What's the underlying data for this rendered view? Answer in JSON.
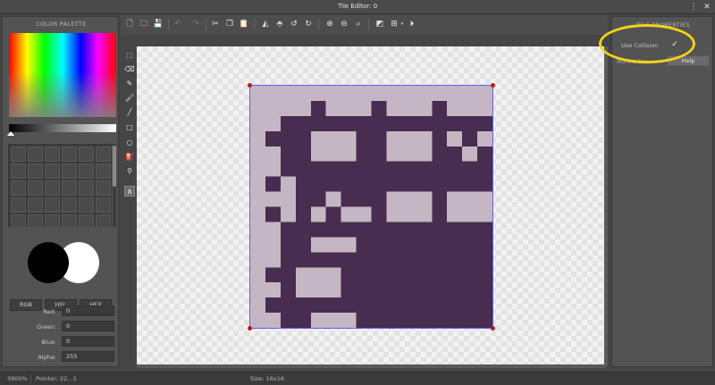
{
  "window": {
    "title": "Tile Editor: 0",
    "menu_icon": "⋮",
    "close_icon": "✕"
  },
  "palette": {
    "title": "COLOR PALETTE",
    "modes": [
      "RGB",
      "HSL",
      "HEX"
    ],
    "primary_color": "#000000",
    "secondary_color": "#ffffff",
    "fields": [
      {
        "label": "Red:",
        "value": "0"
      },
      {
        "label": "Green:",
        "value": "0"
      },
      {
        "label": "Blue:",
        "value": "0"
      },
      {
        "label": "Alpha:",
        "value": "255"
      }
    ]
  },
  "toolbar": {
    "icons": [
      "new-file-icon",
      "open-folder-icon",
      "save-icon",
      "undo-icon",
      "redo-icon",
      "cut-icon",
      "copy-icon",
      "paste-icon",
      "flip-horizontal-icon",
      "flip-vertical-icon",
      "rotate-left-icon",
      "rotate-right-icon",
      "zoom-in-icon",
      "zoom-out-icon",
      "zoom-fit-icon",
      "fill-toggle-icon",
      "grid-icon",
      "play-icon"
    ]
  },
  "tools": [
    "select",
    "eraser",
    "pencil",
    "brush",
    "line",
    "rectangle",
    "ellipse",
    "bucket-fill",
    "eyedropper",
    "transform"
  ],
  "properties": {
    "title": "TILE PROPERTIES",
    "use_collision_label": "Use Collision",
    "use_collision": true,
    "info_label": "More Infor...",
    "help_label": "Help"
  },
  "tile": {
    "size": 16,
    "colors": {
      "dark": "#472d4f",
      "light": "#c4b7c3"
    },
    "pixels": [
      "LLLLLLLLLLLLLLLL",
      "LLLLDLLLDLLLDLLL",
      "LLDDDDDDDDDDDDDD",
      "LDDDLLLDDLLLDLDL",
      "LLDDLLLDDLLLDDLD",
      "LLDDDDDDDDDDDDDD",
      "LDLDDDDDDDDDDDDD",
      "LLLDDLDDDLLLDLLL",
      "LDLDLDLLDLLLDLLL",
      "LLDDDDDDDDDDDDDD",
      "LLDDLLLDDDDDDDDD",
      "LLDDDDDDDDDDDDDD",
      "LDDLLLDDDDDDDDDD",
      "LLDLLLDDDDDDDDDD",
      "LDDDDDDDDDDDDDDD",
      "LLDDLLLDDDDDDDDD",
      "LLDDDDDDDDDDDDDD"
    ]
  },
  "status": {
    "zoom": "3900%",
    "pointer": "Pointer: 22, -1",
    "size": "Size: 16x16"
  }
}
